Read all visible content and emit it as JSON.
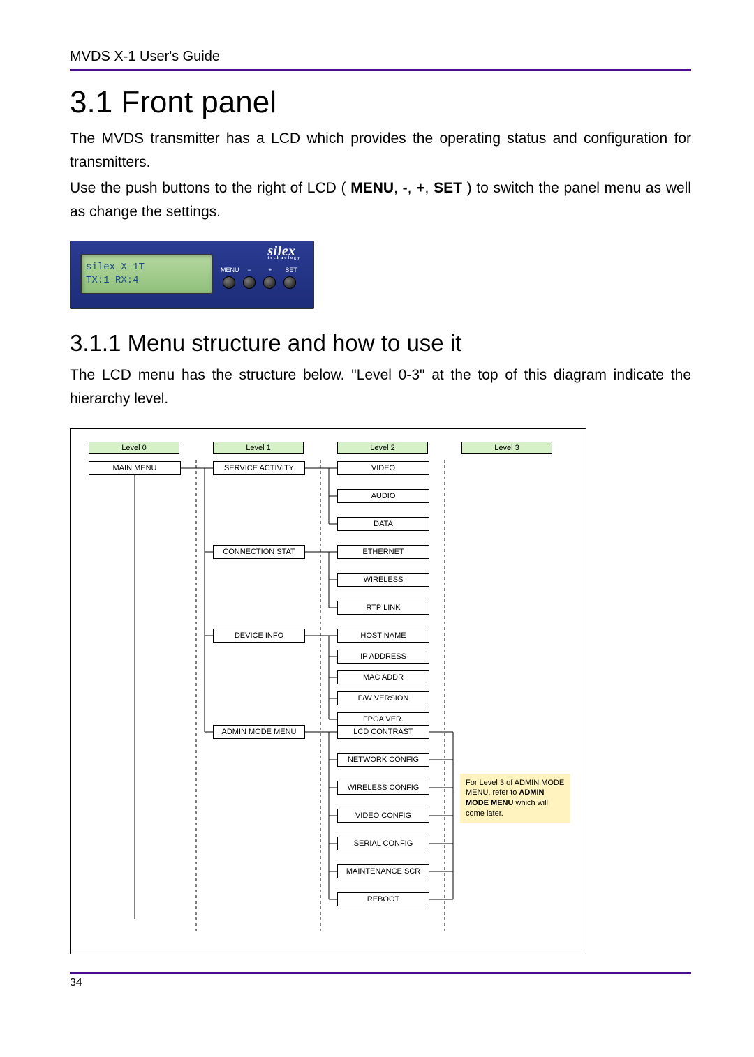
{
  "header": {
    "doc_title": "MVDS X-1 User's Guide"
  },
  "section": {
    "num_title": "3.1 Front panel",
    "para1": "The MVDS transmitter has a LCD which provides the operating status and configuration for transmitters.",
    "para2_pre": "Use the push buttons to the right of LCD ( ",
    "para2_btn1": "MENU",
    "para2_sep": ", ",
    "para2_btn2": "-",
    "para2_btn3": "+",
    "para2_btn4": "SET",
    "para2_post": " ) to switch the panel menu as well as change the settings."
  },
  "device": {
    "lcd_line1": "silex X-1T",
    "lcd_line2": " TX:1  RX:4",
    "brand": "silex",
    "brand_sub": "technology",
    "labels": {
      "menu": "MENU",
      "minus": "−",
      "plus": "+",
      "set": "SET"
    }
  },
  "subsection": {
    "num_title": "3.1.1 Menu structure and how to use it",
    "para": "The LCD menu has the structure below. \"Level 0-3\" at the top of this diagram indicate the hierarchy level."
  },
  "tree": {
    "levels": [
      "Level 0",
      "Level 1",
      "Level 2",
      "Level 3"
    ],
    "root": "MAIN MENU",
    "l1": {
      "service": "SERVICE ACTIVITY",
      "conn": "CONNECTION STAT",
      "devinfo": "DEVICE INFO",
      "admin": "ADMIN MODE MENU"
    },
    "l2": {
      "service": [
        "VIDEO",
        "AUDIO",
        "DATA"
      ],
      "conn": [
        "ETHERNET",
        "WIRELESS",
        "RTP LINK"
      ],
      "devinfo": [
        "HOST NAME",
        "IP ADDRESS",
        "MAC ADDR",
        "F/W VERSION",
        "FPGA VER."
      ],
      "admin": [
        "LCD CONTRAST",
        "NETWORK CONFIG",
        "WIRELESS CONFIG",
        "VIDEO CONFIG",
        "SERIAL CONFIG",
        "MAINTENANCE SCR",
        "REBOOT"
      ]
    },
    "note": {
      "line1": "For Level 3 of ADMIN MODE MENU, refer to ",
      "bold": "ADMIN MODE MENU",
      "line2": " which will come later."
    }
  },
  "footer": {
    "page": "34"
  }
}
